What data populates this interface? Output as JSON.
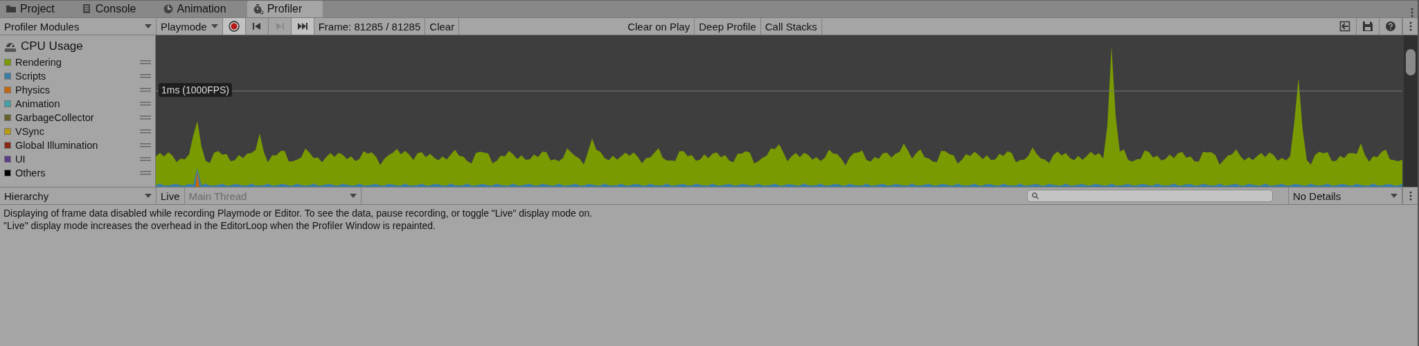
{
  "tabs": [
    {
      "label": "Project",
      "kind": "folder",
      "selected": false
    },
    {
      "label": "Console",
      "kind": "list",
      "selected": false
    },
    {
      "label": "Animation",
      "kind": "clock",
      "selected": false
    },
    {
      "label": "Profiler",
      "kind": "stopwatch",
      "selected": true
    }
  ],
  "toolbar": {
    "modules_dropdown": "Profiler Modules",
    "target_dropdown": "Playmode",
    "record": {
      "active": true
    },
    "transport": [
      {
        "kind": "first",
        "disabled": false
      },
      {
        "kind": "next",
        "disabled": true
      },
      {
        "kind": "last",
        "disabled": false
      }
    ],
    "frame": "Frame: 81285 / 81285",
    "clear": "Clear",
    "toggles": [
      "Clear on Play",
      "Deep Profile",
      "Call Stacks"
    ]
  },
  "module": {
    "title": "CPU Usage",
    "legend": [
      {
        "name": "Rendering",
        "color": "#7a9a01"
      },
      {
        "name": "Scripts",
        "color": "#3a7ea6"
      },
      {
        "name": "Physics",
        "color": "#c4660f"
      },
      {
        "name": "Animation",
        "color": "#45a0a6"
      },
      {
        "name": "GarbageCollector",
        "color": "#66602a"
      },
      {
        "name": "VSync",
        "color": "#b49a12"
      },
      {
        "name": "Global Illumination",
        "color": "#882a12"
      },
      {
        "name": "UI",
        "color": "#5a3e88"
      },
      {
        "name": "Others",
        "color": "#000000"
      }
    ],
    "marker": "1ms (1000FPS)"
  },
  "details": {
    "view_dropdown": "Hierarchy",
    "live": "Live",
    "thread_dropdown": "Main Thread",
    "details_dropdown": "No Details",
    "message": [
      "Displaying of frame data disabled while recording Playmode or Editor. To see the data, pause recording, or toggle \"Live\" display mode on.",
      "\"Live\" display mode increases the overhead in the EditorLoop when the Profiler Window is repainted."
    ]
  }
}
